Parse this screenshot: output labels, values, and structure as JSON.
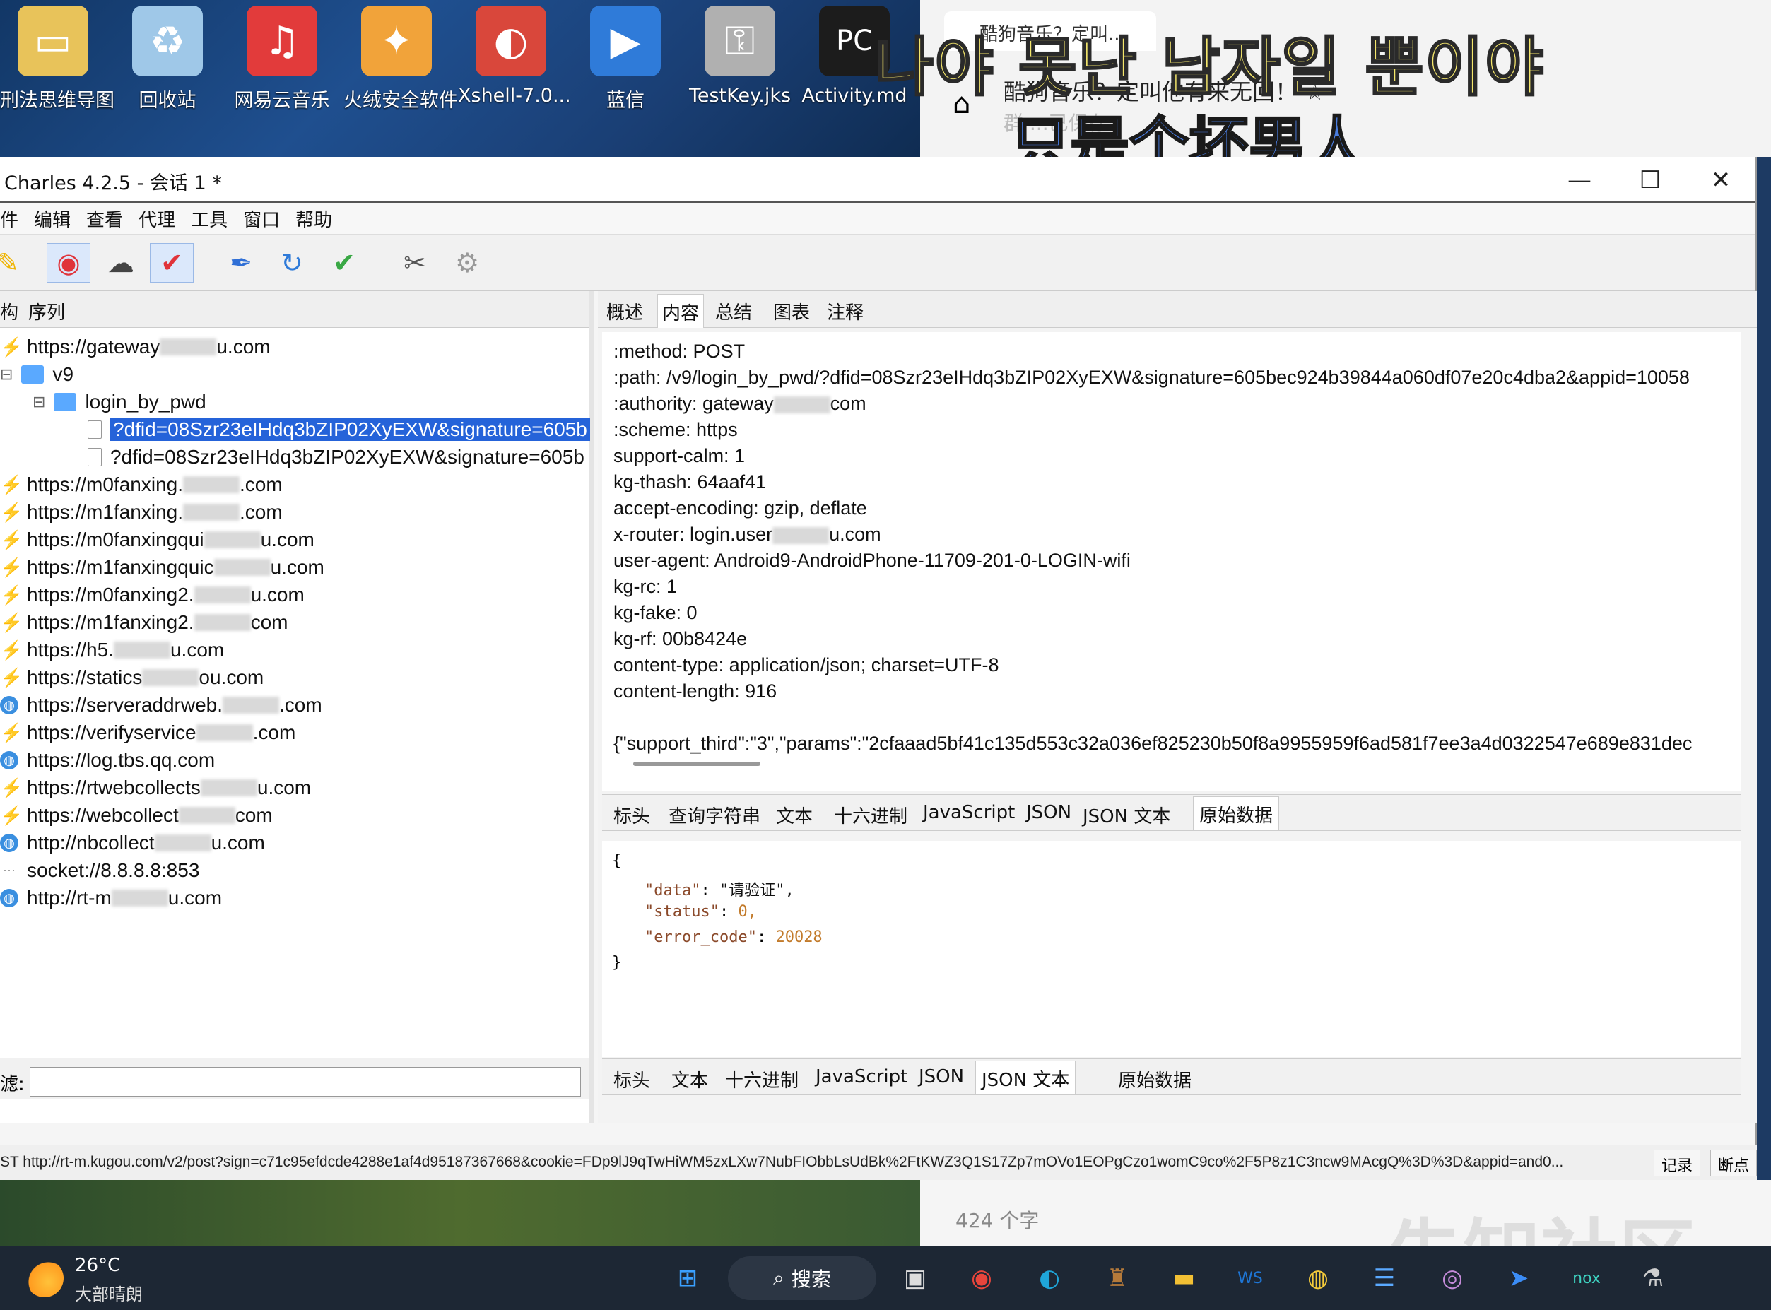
{
  "desktop": {
    "icons": [
      {
        "label": "刑法思维导图",
        "icon": "folder-icon",
        "color": "#e8c35a",
        "glyph": "▭"
      },
      {
        "label": "回收站",
        "icon": "recycle-bin-icon",
        "color": "#9fc8e8",
        "glyph": "♻"
      },
      {
        "label": "网易云音乐",
        "icon": "netease-music-icon",
        "color": "#e23b3b",
        "glyph": "♫"
      },
      {
        "label": "火绒安全软件",
        "icon": "huorong-icon",
        "color": "#f1a33a",
        "glyph": "✦"
      },
      {
        "label": "Xshell-7.0...",
        "icon": "xshell-icon",
        "color": "#d9473b",
        "glyph": "◐"
      },
      {
        "label": "蓝信",
        "icon": "lanxin-icon",
        "color": "#2f7bd9",
        "glyph": "▶"
      },
      {
        "label": "TestKey.jks",
        "icon": "key-file-icon",
        "color": "#b0b0b0",
        "glyph": "⚿"
      },
      {
        "label": "Activity.md",
        "icon": "pycharm-icon",
        "color": "#1c1c1c",
        "glyph": "PC"
      }
    ]
  },
  "browser": {
    "tab_title": "酷狗音乐？定叫...",
    "page_title": "酷狗音乐？定叫他有来无回！ ☆",
    "page_sub": "群   ...已保存"
  },
  "lyrics": {
    "line1": "나야 못난 남자일 뿐이야",
    "line2": "只是个坏男人"
  },
  "window": {
    "title": "Charles 4.2.5 - 会话 1 *",
    "minimize": "—",
    "maximize": "☐",
    "close": "✕"
  },
  "menu": [
    "件",
    "编辑",
    "查看",
    "代理",
    "工具",
    "窗口",
    "帮助"
  ],
  "toolbar": [
    {
      "icon": "broom-icon",
      "glyph": "✎",
      "color": "#f0b400"
    },
    {
      "icon": "record-icon",
      "glyph": "◉",
      "color": "#e0333a"
    },
    {
      "icon": "throttle-turtle-icon",
      "glyph": "☁",
      "color": "#444"
    },
    {
      "icon": "breakpoint-icon",
      "glyph": "✔",
      "color": "#e0333a"
    },
    {
      "icon": "compose-pen-icon",
      "glyph": "✒",
      "color": "#2f6fd6"
    },
    {
      "icon": "repeat-icon",
      "glyph": "↻",
      "color": "#2f7bd9"
    },
    {
      "icon": "validate-check-icon",
      "glyph": "✔",
      "color": "#3aa845"
    },
    {
      "icon": "tools-icon",
      "glyph": "✂",
      "color": "#555"
    },
    {
      "icon": "settings-gear-icon",
      "glyph": "⚙",
      "color": "#999"
    }
  ],
  "left_tabs": [
    "构",
    "序列"
  ],
  "tree": [
    {
      "type": "bolt",
      "text_a": "https://gateway",
      "text_b": "u.com",
      "indent": 0
    },
    {
      "type": "folder",
      "text_a": "v9",
      "text_b": "",
      "indent": 1,
      "toggle": "⊟"
    },
    {
      "type": "folder",
      "text_a": "login_by_pwd",
      "text_b": "",
      "indent": 2,
      "toggle": "⊟"
    },
    {
      "type": "file-selected",
      "text_a": "?dfid=08Szr23eIHdq3bZIP02XyEXW&signature=605b",
      "text_b": "",
      "indent": 3
    },
    {
      "type": "file",
      "text_a": "?dfid=08Szr23eIHdq3bZIP02XyEXW&signature=605b",
      "text_b": "",
      "indent": 3
    },
    {
      "type": "bolt",
      "text_a": "https://m0fanxing.",
      "text_b": ".com",
      "indent": 0
    },
    {
      "type": "bolt",
      "text_a": "https://m1fanxing.",
      "text_b": ".com",
      "indent": 0
    },
    {
      "type": "bolt",
      "text_a": "https://m0fanxingqui",
      "text_b": "u.com",
      "indent": 0
    },
    {
      "type": "bolt",
      "text_a": "https://m1fanxingquic",
      "text_b": "u.com",
      "indent": 0
    },
    {
      "type": "bolt",
      "text_a": "https://m0fanxing2.",
      "text_b": "u.com",
      "indent": 0
    },
    {
      "type": "bolt",
      "text_a": "https://m1fanxing2.",
      "text_b": "com",
      "indent": 0
    },
    {
      "type": "bolt",
      "text_a": "https://h5.",
      "text_b": "u.com",
      "indent": 0
    },
    {
      "type": "bolt",
      "text_a": "https://statics",
      "text_b": "ou.com",
      "indent": 0
    },
    {
      "type": "globe",
      "text_a": "https://serveraddrweb.",
      "text_b": ".com",
      "indent": 0
    },
    {
      "type": "bolt",
      "text_a": "https://verifyservice",
      "text_b": ".com",
      "indent": 0
    },
    {
      "type": "globe",
      "text_a": "https://log.tbs.qq.com",
      "text_b": "",
      "indent": 0
    },
    {
      "type": "bolt",
      "text_a": "https://rtwebcollects",
      "text_b": "u.com",
      "indent": 0
    },
    {
      "type": "bolt",
      "text_a": "https://webcollect",
      "text_b": "com",
      "indent": 0
    },
    {
      "type": "globe",
      "text_a": "http://nbcollect",
      "text_b": "u.com",
      "indent": 0
    },
    {
      "type": "socket",
      "text_a": "socket://8.8.8.8:853",
      "text_b": "",
      "indent": 0
    },
    {
      "type": "globe",
      "text_a": "http://rt-m",
      "text_b": "u.com",
      "indent": 0
    }
  ],
  "filter_label": "滤:",
  "right_tabs": [
    "概述",
    "内容",
    "总结",
    "图表",
    "注释"
  ],
  "request_lines": [
    ":method: POST",
    ":path: /v9/login_by_pwd/?dfid=08Szr23eIHdq3bZIP02XyEXW&signature=605bec924b39844a060df07e20c4dba2&appid=10058",
    ":authority: gateway",
    ":scheme: https",
    "support-calm: 1",
    "kg-thash: 64aaf41",
    "accept-encoding: gzip, deflate",
    "x-router: login.user",
    "user-agent: Android9-AndroidPhone-11709-201-0-LOGIN-wifi",
    "kg-rc: 1",
    "kg-fake: 0",
    "kg-rf: 00b8424e",
    "content-type: application/json; charset=UTF-8",
    "content-length: 916",
    "",
    "{\"support_third\":\"3\",\"params\":\"2cfaaad5bf41c135d553c32a036ef825230b50f8a9955959f6ad581f7ee3a4d0322547e689e831dec"
  ],
  "authority_suffix": "com",
  "router_suffix": "u.com",
  "request_subtabs": [
    "标头",
    "查询字符串",
    "文本",
    "十六进制",
    "JavaScript",
    "JSON",
    "JSON 文本",
    "原始数据"
  ],
  "response_json": {
    "open": "{",
    "k1": "\"data\"",
    "v1": "\"请验证\",",
    "k2": "\"status\"",
    "v2": "0,",
    "k3": "\"error_code\"",
    "v3": "20028",
    "close": "}"
  },
  "response_subtabs": [
    "标头",
    "文本",
    "十六进制",
    "JavaScript",
    "JSON",
    "JSON 文本",
    "原始数据"
  ],
  "status_bar": {
    "url": "ST http://rt-m.kugou.com/v2/post?sign=c71c95efdcde4288e1af4d95187367668&cookie=FDp9lJ9qTwHiWM5zxLXw7NubFIObbLsUdBk%2FtKWZ3Q1S17Zp7mOVo1EOPgCzo1womC9co%2F5P8z1C3ncw9MAcgQ%3D%3D&appid=and0...",
    "record_btn": "记录",
    "break_btn": "断点"
  },
  "notepad_status": "424 个字",
  "watermark": "先知社区",
  "taskbar": {
    "temp": "26°C",
    "cond": "大部晴朗",
    "search": "搜索",
    "apps": [
      {
        "icon": "windows-start-icon",
        "glyph": "⊞",
        "color": "#3aa0ff"
      },
      {
        "icon": "task-view-icon",
        "glyph": "▣",
        "color": "#ddd"
      },
      {
        "icon": "chrome-icon",
        "glyph": "◉",
        "color": "#e8453c"
      },
      {
        "icon": "edge-icon",
        "glyph": "◐",
        "color": "#1fa6d9"
      },
      {
        "icon": "game-icon",
        "glyph": "♜",
        "color": "#b57a3a"
      },
      {
        "icon": "file-explorer-icon",
        "glyph": "▬",
        "color": "#f2c034"
      },
      {
        "icon": "webstorm-icon",
        "glyph": "WS",
        "color": "#1e76d6"
      },
      {
        "icon": "yellow-app-icon",
        "glyph": "◍",
        "color": "#f3c93a"
      },
      {
        "icon": "notepad-icon",
        "glyph": "☰",
        "color": "#5aa9ff"
      },
      {
        "icon": "media-app-icon",
        "glyph": "◎",
        "color": "#c48bd9"
      },
      {
        "icon": "feishu-icon",
        "glyph": "➤",
        "color": "#3b8cf5"
      },
      {
        "icon": "nox-icon",
        "glyph": "nox",
        "color": "#3ed1c0"
      },
      {
        "icon": "charles-icon",
        "glyph": "⚗",
        "color": "#cfcfcf"
      }
    ]
  }
}
